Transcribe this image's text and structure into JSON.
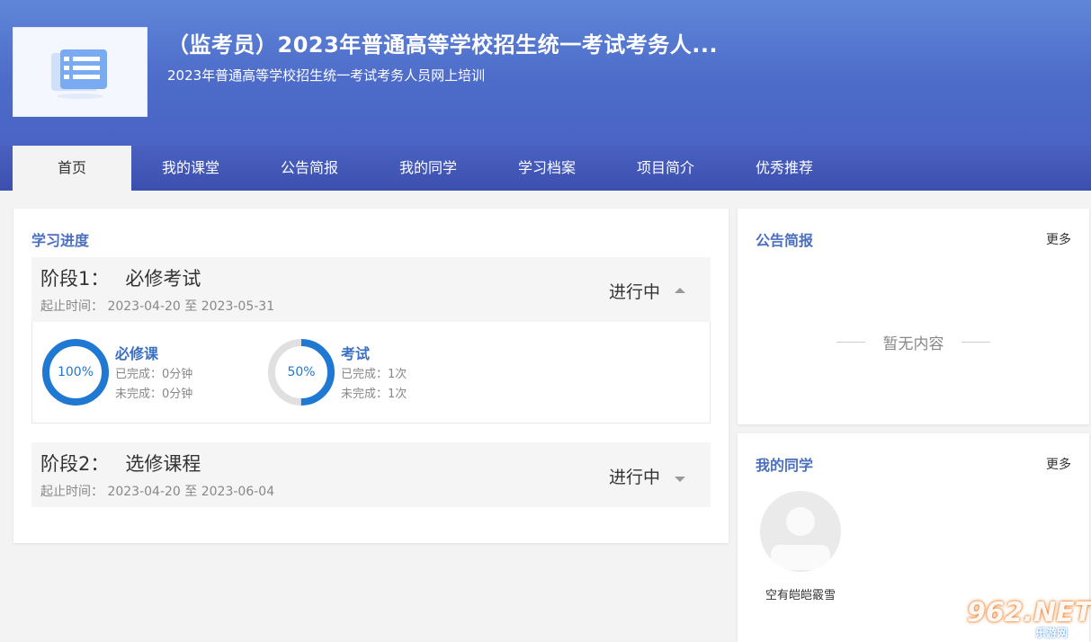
{
  "header": {
    "title": "（监考员）2023年普通高等学校招生统一考试考务人...",
    "subtitle": "2023年普通高等学校招生统一考试考务人员网上培训"
  },
  "nav": {
    "items": [
      {
        "label": "首页",
        "active": true
      },
      {
        "label": "我的课堂"
      },
      {
        "label": "公告简报"
      },
      {
        "label": "我的同学"
      },
      {
        "label": "学习档案"
      },
      {
        "label": "项目简介"
      },
      {
        "label": "优秀推荐"
      }
    ]
  },
  "progress": {
    "title": "学习进度",
    "stages": [
      {
        "name_prefix": "阶段1：",
        "name": "必修考试",
        "time_label": "起止时间：",
        "start": "2023-04-20",
        "sep": "至",
        "end": "2023-05-31",
        "status": "进行中",
        "expanded": true,
        "items": [
          {
            "name": "必修课",
            "percent": 100,
            "percent_label": "100%",
            "done": "已完成：0分钟",
            "undone": "未完成：0分钟"
          },
          {
            "name": "考试",
            "percent": 50,
            "percent_label": "50%",
            "done": "已完成：1次",
            "undone": "未完成：1次"
          }
        ]
      },
      {
        "name_prefix": "阶段2：",
        "name": "选修课程",
        "time_label": "起止时间：",
        "start": "2023-04-20",
        "sep": "至",
        "end": "2023-06-04",
        "status": "进行中",
        "expanded": false
      }
    ]
  },
  "notices": {
    "title": "公告简报",
    "more": "更多",
    "empty": "暂无内容"
  },
  "classmates": {
    "title": "我的同学",
    "more": "更多",
    "list": [
      {
        "name": "空有皑皑霰雪"
      }
    ]
  },
  "watermark": {
    "main": "962.NET",
    "sub": "乐游网"
  },
  "colors": {
    "accent": "#1f78d1",
    "header": "#5f86d8",
    "nav": "#3c4fae",
    "title": "#4a6fbf"
  }
}
